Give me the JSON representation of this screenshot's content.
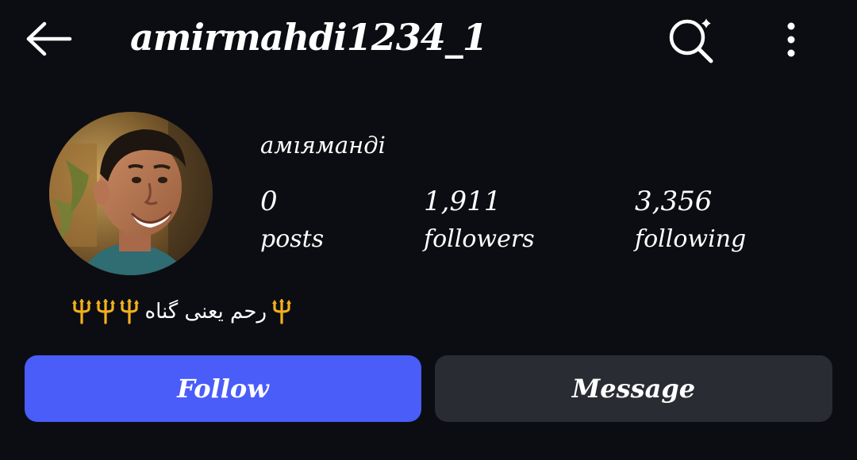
{
  "header": {
    "username": "amirmahdi1234_1"
  },
  "profile": {
    "display_name": "амıяманді",
    "bio_text": "رحم يعنى گناه",
    "stats": [
      {
        "value": "0",
        "label": "posts"
      },
      {
        "value": "1,911",
        "label": "followers"
      },
      {
        "value": "3,356",
        "label": "following"
      }
    ]
  },
  "actions": {
    "follow_label": "Follow",
    "message_label": "Message"
  },
  "colors": {
    "background": "#0c0d12",
    "follow_button": "#4a5df9",
    "message_button": "#2a2c33",
    "text": "#ffffff",
    "trident": "#f2b01e"
  },
  "icons": {
    "back": "arrow-left-icon",
    "search": "search-sparkle-icon",
    "more": "more-vertical-icon",
    "bio_emoji": "trident-emoji-icon"
  }
}
